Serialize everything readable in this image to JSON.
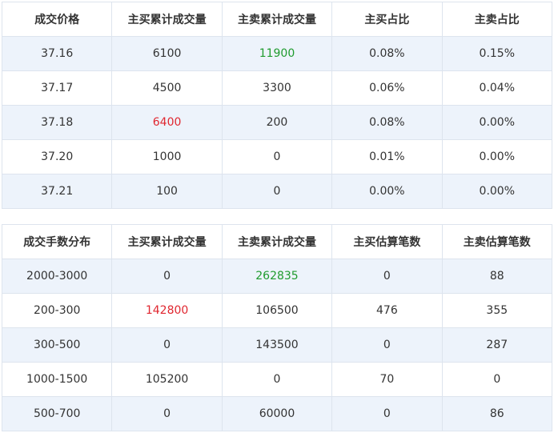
{
  "price_table": {
    "headers": [
      "成交价格",
      "主买累计成交量",
      "主卖累计成交量",
      "主买占比",
      "主卖占比"
    ],
    "rows": [
      [
        "37.16",
        "6100",
        "11900",
        "0.08%",
        "0.15%"
      ],
      [
        "37.17",
        "4500",
        "3300",
        "0.06%",
        "0.04%"
      ],
      [
        "37.18",
        "6400",
        "200",
        "0.08%",
        "0.00%"
      ],
      [
        "37.20",
        "1000",
        "0",
        "0.01%",
        "0.00%"
      ],
      [
        "37.21",
        "100",
        "0",
        "0.00%",
        "0.00%"
      ]
    ]
  },
  "lot_table": {
    "headers": [
      "成交手数分布",
      "主买累计成交量",
      "主卖累计成交量",
      "主买估算笔数",
      "主卖估算笔数"
    ],
    "rows": [
      [
        "2000-3000",
        "0",
        "262835",
        "0",
        "88"
      ],
      [
        "200-300",
        "142800",
        "106500",
        "476",
        "355"
      ],
      [
        "300-500",
        "0",
        "143500",
        "0",
        "287"
      ],
      [
        "1000-1500",
        "105200",
        "0",
        "70",
        "0"
      ],
      [
        "500-700",
        "0",
        "60000",
        "0",
        "86"
      ]
    ]
  },
  "colors": {
    "up": "#e0262f",
    "down": "#1f9b2e",
    "row_shade": "#edf3fb",
    "border": "#dde4ee"
  }
}
